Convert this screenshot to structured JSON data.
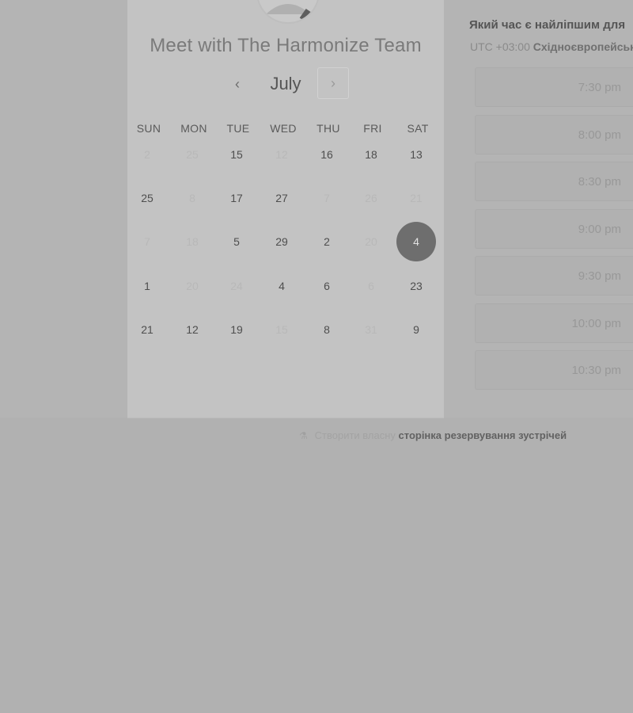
{
  "header": {
    "title": "Meet with The Harmonize Team",
    "month": "July",
    "prev_label": "‹",
    "next_label": "›"
  },
  "weekdays": [
    "SUN",
    "MON",
    "TUE",
    "WED",
    "THU",
    "FRI",
    "SAT"
  ],
  "weeks": [
    [
      {
        "d": "2",
        "a": false
      },
      {
        "d": "25",
        "a": false
      },
      {
        "d": "15",
        "a": true
      },
      {
        "d": "12",
        "a": false
      },
      {
        "d": "16",
        "a": true
      },
      {
        "d": "18",
        "a": true
      },
      {
        "d": "13",
        "a": true
      }
    ],
    [
      {
        "d": "25",
        "a": true
      },
      {
        "d": "8",
        "a": false
      },
      {
        "d": "17",
        "a": true
      },
      {
        "d": "27",
        "a": true
      },
      {
        "d": "7",
        "a": false
      },
      {
        "d": "26",
        "a": false
      },
      {
        "d": "21",
        "a": false
      }
    ],
    [
      {
        "d": "7",
        "a": false
      },
      {
        "d": "18",
        "a": false
      },
      {
        "d": "5",
        "a": true
      },
      {
        "d": "29",
        "a": true
      },
      {
        "d": "2",
        "a": true
      },
      {
        "d": "20",
        "a": false
      },
      {
        "d": "4",
        "a": true,
        "selected": true
      }
    ],
    [
      {
        "d": "1",
        "a": true
      },
      {
        "d": "20",
        "a": false
      },
      {
        "d": "24",
        "a": false
      },
      {
        "d": "4",
        "a": true
      },
      {
        "d": "6",
        "a": true
      },
      {
        "d": "6",
        "a": false
      },
      {
        "d": "23",
        "a": true
      }
    ],
    [
      {
        "d": "21",
        "a": true
      },
      {
        "d": "12",
        "a": true
      },
      {
        "d": "19",
        "a": true
      },
      {
        "d": "15",
        "a": false
      },
      {
        "d": "8",
        "a": true
      },
      {
        "d": "31",
        "a": false
      },
      {
        "d": "9",
        "a": true
      }
    ]
  ],
  "times_panel": {
    "question": "Який час є найліпшим для",
    "timezone_offset": "UTC +03:00",
    "timezone_name": "Східноєвропейськ",
    "slots": [
      "7:30 pm",
      "8:00 pm",
      "8:30 pm",
      "9:00 pm",
      "9:30 pm",
      "10:00 pm",
      "10:30 pm"
    ]
  },
  "footer": {
    "prefix": "Створити власну",
    "link": "сторінка резервування зустрічей"
  }
}
